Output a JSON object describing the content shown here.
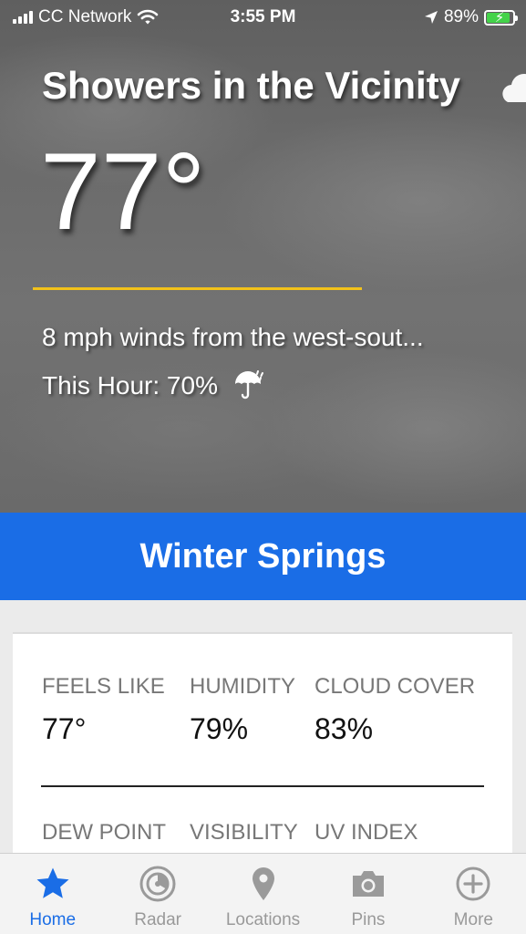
{
  "status_bar": {
    "carrier": "CC Network",
    "time": "3:55 PM",
    "battery": "89%"
  },
  "current": {
    "condition": "Showers in the Vicinity",
    "temperature": "77°",
    "wind": "8 mph winds from the west-sout...",
    "precip": "This Hour: 70%",
    "condition_icon": "cloud-icon",
    "precip_icon": "umbrella-rain-icon"
  },
  "location": {
    "name": "Winter Springs"
  },
  "details": {
    "row1": [
      {
        "label": "FEELS LIKE",
        "value": "77°"
      },
      {
        "label": "HUMIDITY",
        "value": "79%"
      },
      {
        "label": "CLOUD COVER",
        "value": "83%"
      }
    ],
    "row2": [
      {
        "label": "DEW POINT"
      },
      {
        "label": "VISIBILITY"
      },
      {
        "label": "UV INDEX"
      }
    ]
  },
  "tabs": [
    {
      "label": "Home",
      "icon": "star-icon",
      "active": true
    },
    {
      "label": "Radar",
      "icon": "radar-icon",
      "active": false
    },
    {
      "label": "Locations",
      "icon": "location-pin-icon",
      "active": false
    },
    {
      "label": "Pins",
      "icon": "camera-icon",
      "active": false
    },
    {
      "label": "More",
      "icon": "plus-circle-icon",
      "active": false
    }
  ],
  "colors": {
    "accent_blue": "#1a6de6",
    "divider_yellow": "#f2c21b",
    "battery_green": "#44d34a"
  }
}
